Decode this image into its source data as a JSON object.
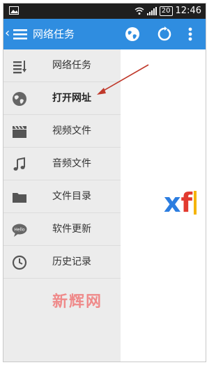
{
  "status_bar": {
    "battery": "20",
    "time": "12:46"
  },
  "app_bar": {
    "back_glyph": "‹",
    "title": "网络任务"
  },
  "drawer": {
    "items": [
      {
        "label": "网络任务",
        "icon": "list-sort-icon"
      },
      {
        "label": "打开网址",
        "icon": "globe-icon"
      },
      {
        "label": "视频文件",
        "icon": "clapper-icon"
      },
      {
        "label": "音频文件",
        "icon": "music-note-icon"
      },
      {
        "label": "文件目录",
        "icon": "folder-icon"
      },
      {
        "label": "软件更新",
        "icon": "hello-bubble-icon"
      },
      {
        "label": "历史记录",
        "icon": "clock-icon"
      }
    ]
  },
  "content": {
    "logo_x": "x",
    "logo_f": "f"
  },
  "watermark": "新辉网",
  "colors": {
    "app_bar": "#2f8de0",
    "drawer": "#ececec",
    "arrow": "#c0392b"
  }
}
